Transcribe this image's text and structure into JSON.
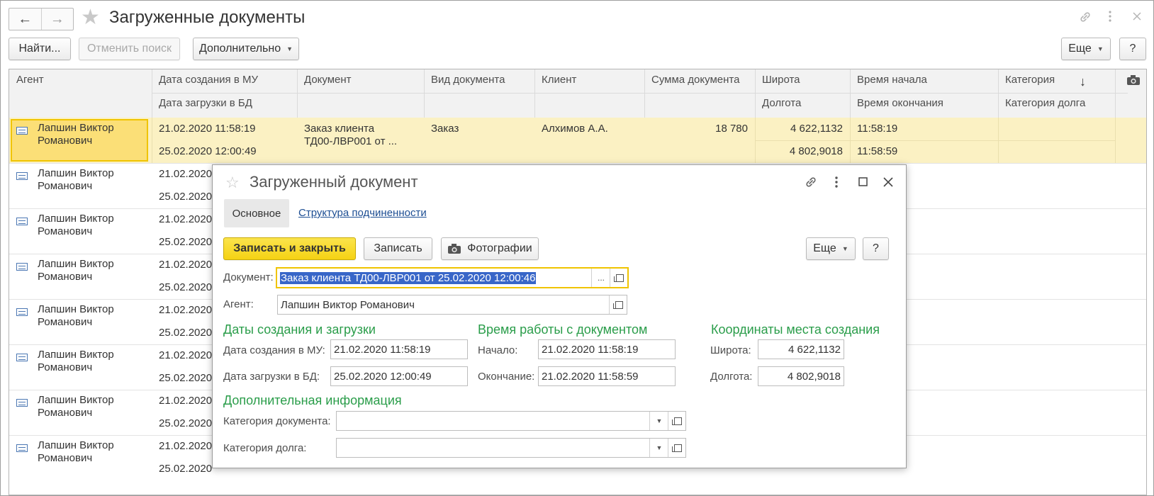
{
  "window": {
    "title": "Загруженные документы",
    "back_label": "←",
    "forward_label": "→",
    "favorite_icon": "star-icon",
    "link_icon": "link-icon",
    "more_icon": "kebab-icon",
    "close_icon": "close-icon"
  },
  "toolbar": {
    "find_label": "Найти...",
    "cancel_search_label": "Отменить поиск",
    "more_options_label": "Дополнительно",
    "more_label": "Еще",
    "help_label": "?"
  },
  "grid": {
    "headers_top": [
      "Агент",
      "Дата создания в МУ",
      "Документ",
      "Вид документа",
      "Клиент",
      "Сумма документа",
      "Широта",
      "Время начала",
      "Категория"
    ],
    "headers_bottom": [
      "Дата загрузки в БД",
      "Долгота",
      "Время окончания",
      "Категория долга"
    ],
    "sort_indicator": "↓",
    "camera_icon": "camera-icon",
    "selected_row": {
      "agent_line1": "Лапшин Виктор",
      "agent_line2": "Романович",
      "created": "21.02.2020 11:58:19",
      "loaded": "25.02.2020 12:00:49",
      "doc_line1": "Заказ клиента",
      "doc_line2": "ТД00-ЛВР001 от ...",
      "doc_type": "Заказ",
      "client": "Алхимов А.А.",
      "sum": "18 780",
      "latitude": "4 622,1132",
      "longitude": "4 802,9018",
      "time_start": "11:58:19",
      "time_end": "11:58:59"
    },
    "rows": [
      {
        "agent_line1": "Лапшин Виктор",
        "agent_line2": "Романович",
        "created": "21.02.2020",
        "loaded": "25.02.2020"
      },
      {
        "agent_line1": "Лапшин Виктор",
        "agent_line2": "Романович",
        "created": "21.02.2020",
        "loaded": "25.02.2020"
      },
      {
        "agent_line1": "Лапшин Виктор",
        "agent_line2": "Романович",
        "created": "21.02.2020",
        "loaded": "25.02.2020"
      },
      {
        "agent_line1": "Лапшин Виктор",
        "agent_line2": "Романович",
        "created": "21.02.2020",
        "loaded": "25.02.2020"
      },
      {
        "agent_line1": "Лапшин Виктор",
        "agent_line2": "Романович",
        "created": "21.02.2020",
        "loaded": "25.02.2020"
      },
      {
        "agent_line1": "Лапшин Виктор",
        "agent_line2": "Романович",
        "created": "21.02.2020",
        "loaded": "25.02.2020"
      },
      {
        "agent_line1": "Лапшин Виктор",
        "agent_line2": "Романович",
        "created": "21.02.2020",
        "loaded": "25.02.2020"
      }
    ]
  },
  "modal": {
    "title": "Загруженный документ",
    "tab_main": "Основное",
    "tab_structure": "Структура подчиненности",
    "save_close_label": "Записать и закрыть",
    "save_label": "Записать",
    "photos_label": "Фотографии",
    "more_label": "Еще",
    "help_label": "?",
    "document_label": "Документ:",
    "document_value": "Заказ клиента ТД00-ЛВР001 от 25.02.2020 12:00:46",
    "agent_label": "Агент:",
    "agent_value": "Лапшин Виктор Романович",
    "dates_section": "Даты создания и загрузки",
    "created_label": "Дата создания в МУ:",
    "created_value": "21.02.2020 11:58:19",
    "loaded_label": "Дата загрузки в БД:",
    "loaded_value": "25.02.2020 12:00:49",
    "worktime_section": "Время работы с документом",
    "start_label": "Начало:",
    "start_value": "21.02.2020 11:58:19",
    "end_label": "Окончание:",
    "end_value": "21.02.2020 11:58:59",
    "coords_section": "Координаты места создания",
    "lat_label": "Широта:",
    "lat_value": "4 622,1132",
    "lon_label": "Долгота:",
    "lon_value": "4 802,9018",
    "extra_section": "Дополнительная информация",
    "doc_category_label": "Категория документа:",
    "doc_category_value": "",
    "debt_category_label": "Категория долга:",
    "debt_category_value": "",
    "choose_button": "..."
  }
}
